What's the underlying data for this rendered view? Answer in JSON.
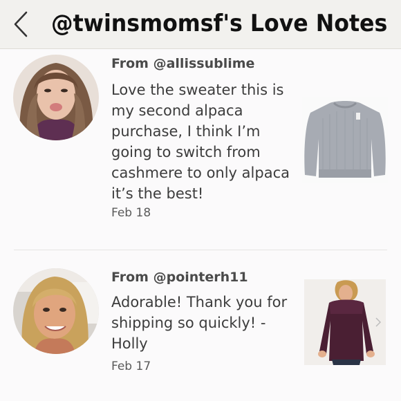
{
  "header": {
    "title": "@twinsmomsf's Love Notes"
  },
  "notes": [
    {
      "from": "From @allissublime",
      "message": "Love the sweater this is my second alpaca purchase, I think I’m going to switch from cashmere to only alpaca it’s the best!",
      "date": "Feb 18"
    },
    {
      "from": "From @pointerh11",
      "message": "Adorable! Thank you for shipping so quickly! - Holly",
      "date": "Feb 17"
    }
  ],
  "icons": {
    "back": "chevron-left-icon"
  },
  "colors": {
    "header_bg": "#f2f1ee",
    "page_bg": "#fbfafb",
    "text": "#4a4a4a"
  }
}
